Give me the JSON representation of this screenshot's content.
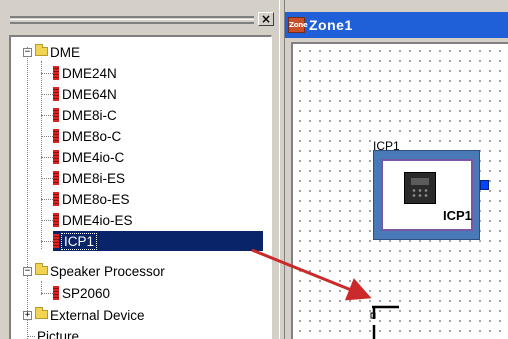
{
  "left_panel": {
    "close_glyph": "×",
    "tree": {
      "root": {
        "label": "DME",
        "icon": "folder-icon",
        "expander": "−"
      },
      "dme_items": [
        {
          "label": "DME24N",
          "icon": "device-icon"
        },
        {
          "label": "DME64N",
          "icon": "device-icon"
        },
        {
          "label": "DME8i-C",
          "icon": "device-icon"
        },
        {
          "label": "DME8o-C",
          "icon": "device-icon"
        },
        {
          "label": "DME4io-C",
          "icon": "device-icon"
        },
        {
          "label": "DME8i-ES",
          "icon": "device-icon"
        },
        {
          "label": "DME8o-ES",
          "icon": "device-icon"
        },
        {
          "label": "DME4io-ES",
          "icon": "device-icon"
        },
        {
          "label": "ICP1",
          "icon": "device-icon",
          "selected": true
        }
      ],
      "speaker_processor": {
        "label": "Speaker Processor",
        "expander": "−",
        "icon": "folder-icon"
      },
      "speaker_items": [
        {
          "label": "SP2060",
          "icon": "device-icon"
        }
      ],
      "external_device": {
        "label": "External Device",
        "expander": "+",
        "icon": "folder-icon"
      },
      "picture": {
        "label": "Picture"
      }
    }
  },
  "zone_window": {
    "icon_text": "Zone",
    "title": "Zone1",
    "component": {
      "caption": "ICP1",
      "label": "ICP1"
    }
  },
  "colors": {
    "selection": "#0a246a",
    "titlebar": "#1f5fd8",
    "component": "#4a79b8",
    "arrow": "#cc2a2a",
    "port": "#0044ff"
  }
}
